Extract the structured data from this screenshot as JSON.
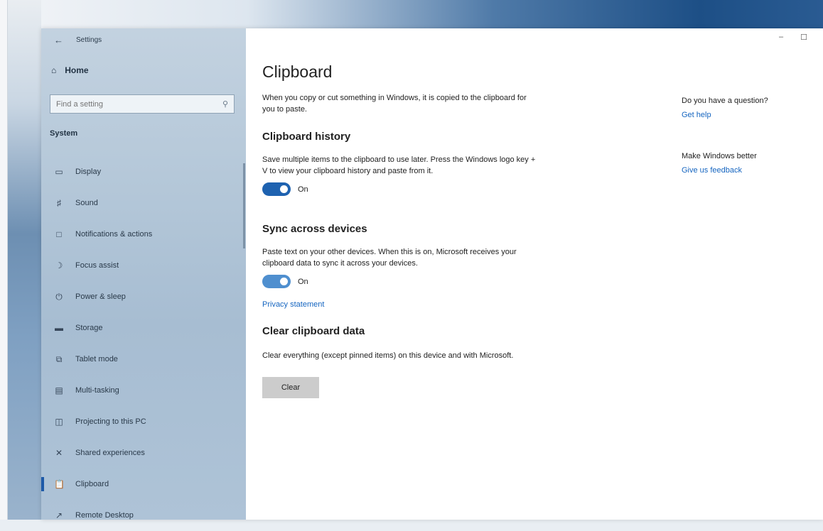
{
  "window": {
    "title": "Settings",
    "controls": {
      "minimize": "–",
      "maximize": "☐"
    }
  },
  "sidebar": {
    "home_label": "Home",
    "search_placeholder": "Find a setting",
    "section_label": "System",
    "items": [
      {
        "label": "Display",
        "icon": "display-icon"
      },
      {
        "label": "Sound",
        "icon": "sound-icon"
      },
      {
        "label": "Notifications & actions",
        "icon": "notifications-icon"
      },
      {
        "label": "Focus assist",
        "icon": "focus-assist-icon"
      },
      {
        "label": "Power & sleep",
        "icon": "power-icon"
      },
      {
        "label": "Storage",
        "icon": "storage-icon"
      },
      {
        "label": "Tablet mode",
        "icon": "tablet-mode-icon"
      },
      {
        "label": "Multi-tasking",
        "icon": "multitasking-icon"
      },
      {
        "label": "Projecting to this PC",
        "icon": "projecting-icon"
      },
      {
        "label": "Shared experiences",
        "icon": "shared-experiences-icon"
      },
      {
        "label": "Clipboard",
        "icon": "clipboard-icon",
        "active": true
      },
      {
        "label": "Remote Desktop",
        "icon": "remote-desktop-icon"
      }
    ]
  },
  "main": {
    "title": "Clipboard",
    "intro": "When you copy or cut something in Windows, it is copied to the clipboard for you to paste.",
    "history": {
      "heading": "Clipboard history",
      "description": "Save multiple items to the clipboard to use later. Press the Windows logo key + V to view your clipboard history and paste from it.",
      "toggle_state": "On"
    },
    "sync": {
      "heading": "Sync across devices",
      "description": "Paste text on your other devices. When this is on, Microsoft receives your clipboard data to sync it across your devices.",
      "toggle_state": "On",
      "privacy_link": "Privacy statement"
    },
    "clear": {
      "heading": "Clear clipboard data",
      "description": "Clear everything (except pinned items) on this device and with Microsoft.",
      "button_label": "Clear"
    }
  },
  "aside": {
    "question_heading": "Do you have a question?",
    "help_link": "Get help",
    "feedback_heading": "Make Windows better",
    "feedback_link": "Give us feedback"
  },
  "colors": {
    "accent": "#1e62b0",
    "link": "#1565c0",
    "sidebar_bg": "#b5c8d9"
  }
}
